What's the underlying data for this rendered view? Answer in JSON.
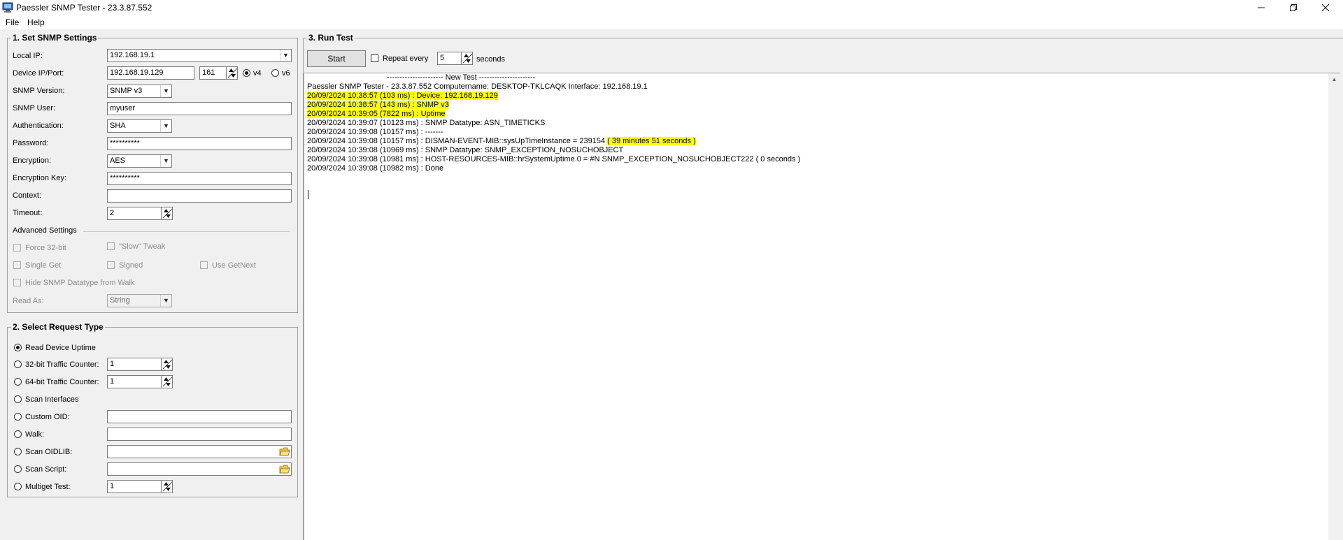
{
  "window": {
    "title": "Paessler SNMP Tester - 23.3.87.552",
    "icon": "monitor-app-icon",
    "controls": {
      "minimize": "minimize-icon",
      "restore": "restore-icon",
      "close": "close-icon"
    }
  },
  "menu": {
    "file": "File",
    "help": "Help"
  },
  "settings": {
    "title": "1. Set SNMP Settings",
    "local_ip_label": "Local IP:",
    "local_ip_value": "192.168.19.1",
    "device_label": "Device IP/Port:",
    "device_ip": "192.168.19.129",
    "device_port": "161",
    "v4": "v4",
    "v6": "v6",
    "version_label": "SNMP Version:",
    "version_value": "SNMP v3",
    "user_label": "SNMP User:",
    "user_value": "myuser",
    "auth_label": "Authentication:",
    "auth_value": "SHA",
    "password_label": "Password:",
    "password_value": "**********",
    "encryption_label": "Encryption:",
    "encryption_value": "AES",
    "enc_key_label": "Encryption Key:",
    "enc_key_value": "**********",
    "context_label": "Context:",
    "context_value": "",
    "timeout_label": "Timeout:",
    "timeout_value": "2",
    "advanced_label": "Advanced Settings",
    "force32": "Force 32-bit",
    "slow_tweak": "\"Slow\" Tweak",
    "single_get": "Single Get",
    "signed": "Signed",
    "use_getnext": "Use GetNext",
    "hide_datatype": "Hide SNMP Datatype from Walk",
    "read_as_label": "Read As:",
    "read_as_value": "String"
  },
  "request": {
    "title": "2. Select Request Type",
    "read_uptime": "Read Device Uptime",
    "traffic32": "32-bit Traffic Counter:",
    "traffic32_value": "1",
    "traffic64": "64-bit Traffic Counter:",
    "traffic64_value": "1",
    "scan_interfaces": "Scan Interfaces",
    "custom_oid": "Custom OID:",
    "custom_oid_value": "",
    "walk": "Walk:",
    "walk_value": "",
    "scan_oidlib": "Scan OIDLIB:",
    "scan_oidlib_value": "",
    "scan_script": "Scan Script:",
    "scan_script_value": "",
    "multiget": "Multiget Test:",
    "multiget_value": "1"
  },
  "run": {
    "title": "3. Run Test",
    "start": "Start",
    "repeat": "Repeat every",
    "repeat_value": "5",
    "seconds": "seconds"
  },
  "log": [
    {
      "text": "---------------------- New Test ----------------------",
      "hl": ""
    },
    {
      "text": "Paessler SNMP Tester - 23.3.87.552 Computername: DESKTOP-TKLCAQK Interface: 192.168.19.1",
      "hl": ""
    },
    {
      "text": "",
      "hl": "20/09/2024 10:38:57 (103 ms) : Device: 192.168.19.129"
    },
    {
      "text": "",
      "hl": "20/09/2024 10:38:57 (143 ms) : SNMP v3"
    },
    {
      "text": "",
      "hl": "20/09/2024 10:39:05 (7822 ms) : Uptime"
    },
    {
      "text": "20/09/2024 10:39:07 (10123 ms) : SNMP Datatype: ASN_TIMETICKS",
      "hl": ""
    },
    {
      "text": "20/09/2024 10:39:08 (10157 ms) : -------",
      "hl": ""
    },
    {
      "text": "20/09/2024 10:39:08 (10157 ms) : DISMAN-EVENT-MIB::sysUpTimeInstance = 239154 ",
      "hl": "( 39 minutes 51 seconds )"
    },
    {
      "text": "20/09/2024 10:39:08 (10969 ms) : SNMP Datatype: SNMP_EXCEPTION_NOSUCHOBJECT",
      "hl": ""
    },
    {
      "text": "20/09/2024 10:39:08 (10981 ms) : HOST-RESOURCES-MIB::hrSystemUptime.0 = #N SNMP_EXCEPTION_NOSUCHOBJECT222 ( 0 seconds )",
      "hl": ""
    },
    {
      "text": "20/09/2024 10:39:08 (10982 ms) : Done",
      "hl": ""
    }
  ],
  "colors": {
    "highlight": "#ffff00",
    "window_bg": "#f0f0f0"
  }
}
